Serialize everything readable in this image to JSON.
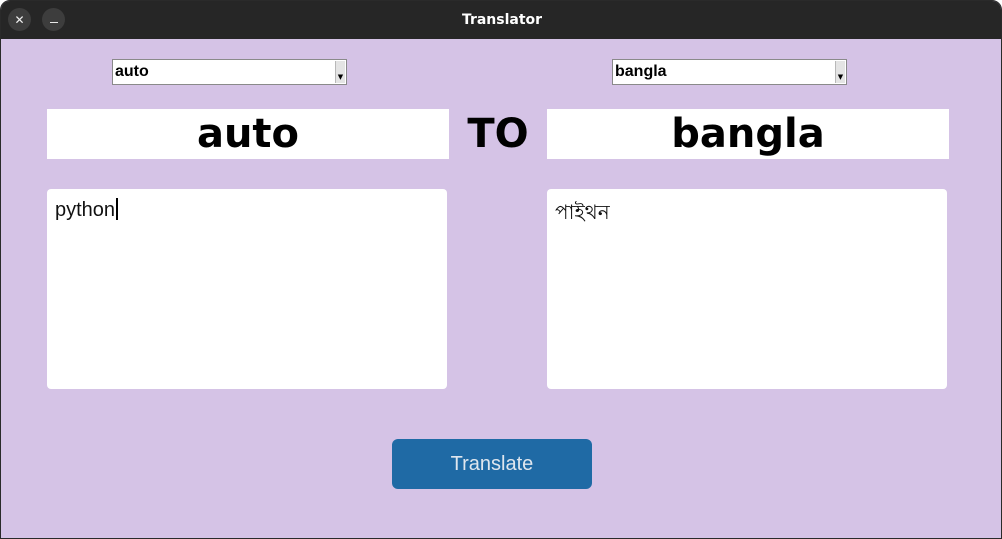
{
  "window": {
    "title": "Translator"
  },
  "source": {
    "selected": "auto",
    "label": "auto",
    "text": "python"
  },
  "middle": {
    "label": "TO"
  },
  "target": {
    "selected": "bangla",
    "label": "bangla",
    "text": "পাইথন"
  },
  "action": {
    "translate_label": "Translate"
  },
  "colors": {
    "background": "#d5c3e6",
    "titlebar": "#262626",
    "button": "#1f6aa5"
  },
  "icons": {
    "close": "close-icon",
    "minimize": "minimize-icon",
    "dropdown": "chevron-down-icon"
  }
}
